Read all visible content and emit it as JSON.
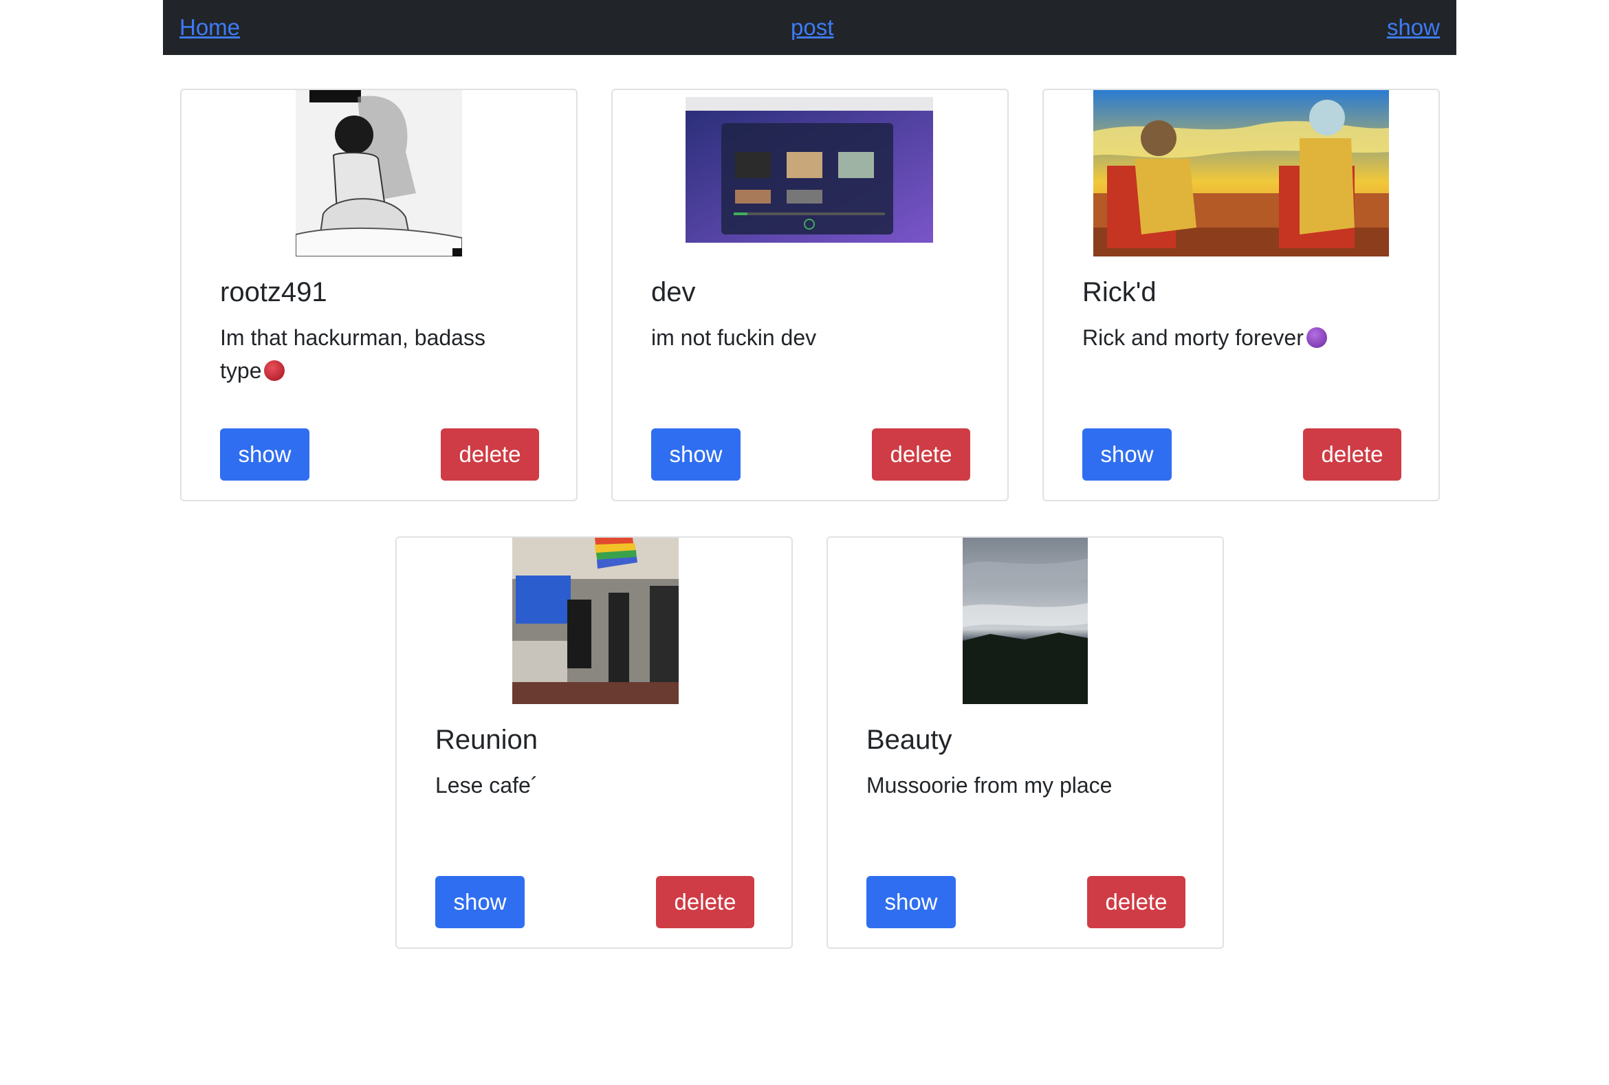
{
  "nav": {
    "home": "Home",
    "post": "post",
    "show": "show"
  },
  "cards": [
    {
      "title": "rootz491",
      "text": "Im that hackurman, badass type",
      "emoji": "red-devil-emoji-icon",
      "show_label": "show",
      "delete_label": "delete"
    },
    {
      "title": "dev",
      "text": "im not fuckin dev",
      "show_label": "show",
      "delete_label": "delete"
    },
    {
      "title": "Rick'd",
      "text": "Rick and morty forever",
      "emoji": "purple-devil-emoji-icon",
      "show_label": "show",
      "delete_label": "delete"
    },
    {
      "title": "Reunion",
      "text": "Lese cafe´",
      "show_label": "show",
      "delete_label": "delete"
    },
    {
      "title": "Beauty",
      "text": "Mussoorie from my place",
      "show_label": "show",
      "delete_label": "delete"
    }
  ],
  "colors": {
    "navbar": "#212529",
    "link": "#3d7bf6",
    "show_button": "#2f6ef0",
    "delete_button": "#cf3c45"
  }
}
